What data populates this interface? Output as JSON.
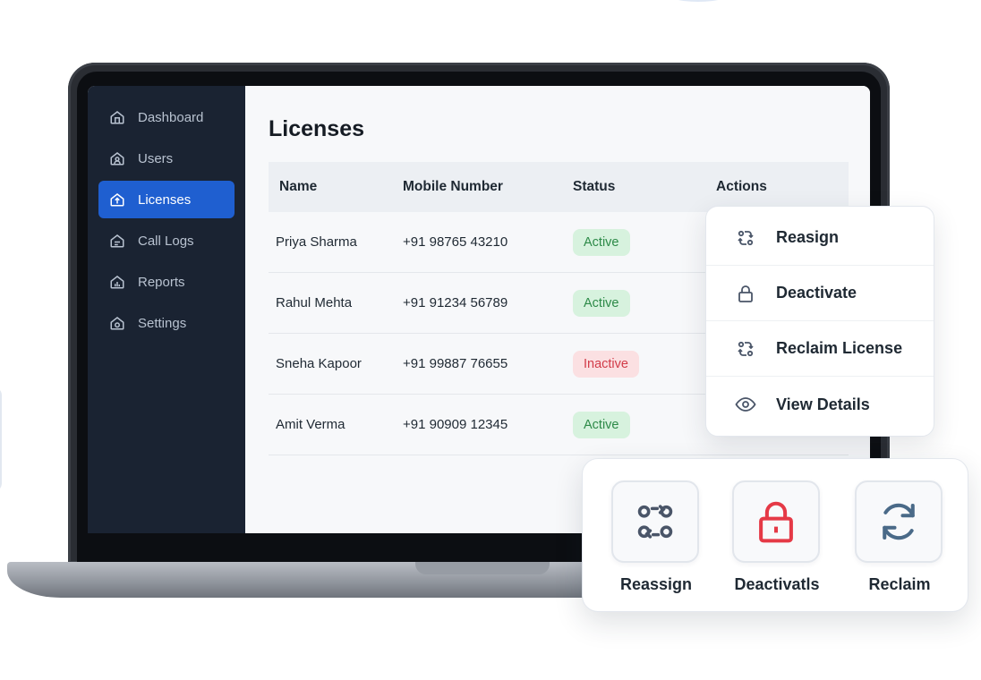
{
  "sidebar": {
    "items": [
      {
        "label": "Dashboard",
        "icon": "home-icon"
      },
      {
        "label": "Users",
        "icon": "users-icon"
      },
      {
        "label": "Licenses",
        "icon": "license-icon",
        "active": true
      },
      {
        "label": "Call Logs",
        "icon": "call-logs-icon"
      },
      {
        "label": "Reports",
        "icon": "reports-icon"
      },
      {
        "label": "Settings",
        "icon": "settings-icon"
      }
    ]
  },
  "main": {
    "title": "Licenses",
    "columns": [
      "Name",
      "Mobile Number",
      "Status",
      "Actions"
    ],
    "rows": [
      {
        "name": "Priya Sharma",
        "mobile": "+91 98765 43210",
        "status": "Active"
      },
      {
        "name": "Rahul Mehta",
        "mobile": "+91 91234 56789",
        "status": "Active"
      },
      {
        "name": "Sneha Kapoor",
        "mobile": "+91 99887 76655",
        "status": "Inactive"
      },
      {
        "name": "Amit Verma",
        "mobile": "+91 90909 12345",
        "status": "Active"
      }
    ]
  },
  "menu": {
    "items": [
      {
        "label": "Reasign",
        "icon": "reassign-icon"
      },
      {
        "label": "Deactivate",
        "icon": "lock-icon"
      },
      {
        "label": "Reclaim License",
        "icon": "reclaim-icon"
      },
      {
        "label": "View Details",
        "icon": "eye-icon"
      }
    ]
  },
  "cards": {
    "items": [
      {
        "label": "Reassign",
        "icon": "reassign-icon"
      },
      {
        "label": "Deactivatls",
        "icon": "lock-icon"
      },
      {
        "label": "Reclaim",
        "icon": "refresh-icon"
      }
    ]
  },
  "colors": {
    "sidebar_bg": "#1a2332",
    "accent": "#1f5fd0",
    "active_badge": "#d7f2de",
    "inactive_badge": "#fbe0e2",
    "danger": "#e53946"
  }
}
